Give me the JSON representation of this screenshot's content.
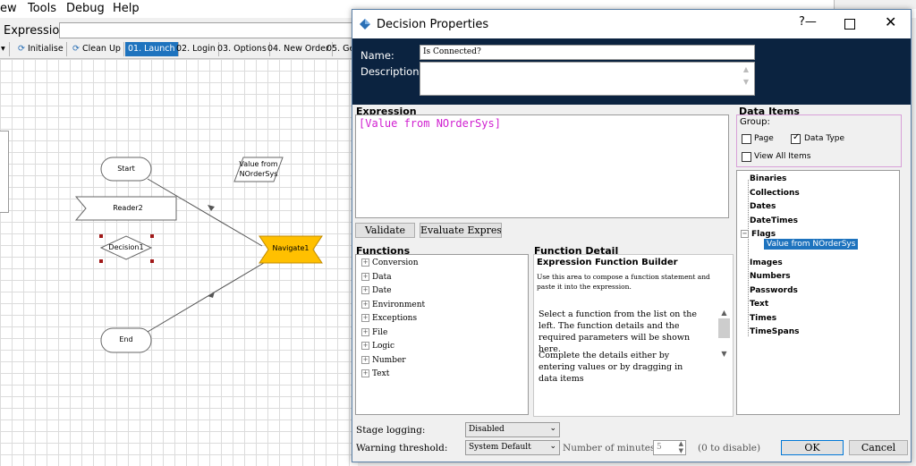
{
  "app": {
    "menu": [
      "ew",
      "Tools",
      "Debug",
      "Help"
    ],
    "expression_label": "Expression:",
    "tabs": [
      "Initialise",
      "Clean Up",
      "01. Launch",
      "02. Login",
      "03. Options",
      "04. New Order",
      "05. Ge"
    ],
    "active_tab": "01. Launch",
    "canvas": {
      "start": "Start",
      "reader": "Reader2",
      "decision": "Decision1",
      "navigate": "Navigate1",
      "end": "End",
      "data_item_line1": "Value from",
      "data_item_line2": "NOrderSys"
    }
  },
  "dialog": {
    "title": "Decision Properties",
    "help": "?",
    "name_label": "Name:",
    "name_value": "Is Connected?",
    "description_label": "Description:",
    "description_value": "",
    "expression_label": "Expression",
    "expression_value": "[Value from NOrderSys]",
    "validate_button": "Validate",
    "evaluate_button": "Evaluate Expressi",
    "functions_label": "Functions",
    "functions": [
      "Conversion",
      "Data",
      "Date",
      "Environment",
      "Exceptions",
      "File",
      "Logic",
      "Number",
      "Text"
    ],
    "function_detail_label": "Function Detail",
    "fd_title": "Expression Function Builder",
    "fd_desc": "Use this area to compose a function statement and paste it into the expression.",
    "fd_body1": "Select a function from the list on the left. The function details and the required parameters will be shown here.",
    "fd_body2": "Complete the details either by entering values or by dragging in data items",
    "data_items_label": "Data Items",
    "group_label": "Group:",
    "page_checkbox": "Page",
    "datatype_checkbox": "Data Type",
    "view_all": "View All Items",
    "data_items": [
      "Binaries",
      "Collections",
      "Dates",
      "DateTimes",
      "Flags",
      "Images",
      "Numbers",
      "Passwords",
      "Text",
      "Times",
      "TimeSpans"
    ],
    "flags_child": "Value from NOrderSys",
    "stage_logging_label": "Stage logging:",
    "stage_logging_value": "Disabled",
    "warning_label": "Warning threshold:",
    "warning_value": "System Default",
    "minutes_label": "Number of minutes",
    "minutes_value": "5",
    "disable_hint": "(0 to disable)",
    "ok_button": "OK",
    "cancel_button": "Cancel"
  },
  "colors": {
    "header_bg": "#0b2340",
    "expression_text": "#d020d0",
    "active_tab": "#1e73be",
    "selection": "#1e73be",
    "navigate_fill": "#ffc000"
  }
}
